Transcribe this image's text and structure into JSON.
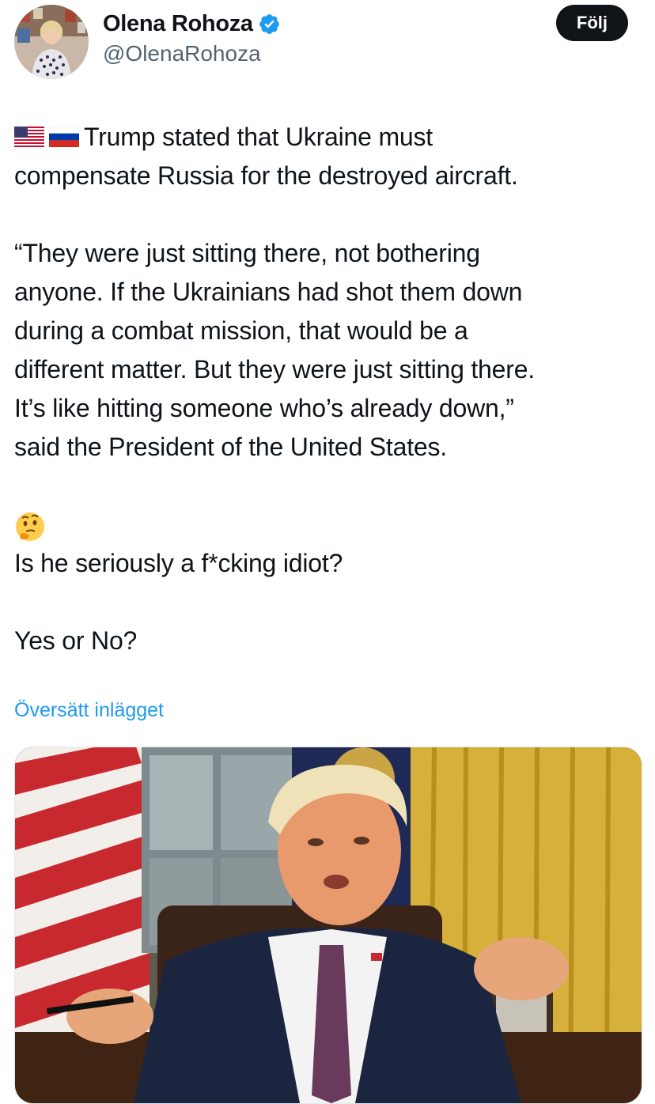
{
  "author": {
    "display_name": "Olena Rohoza",
    "handle": "@OlenaRohoza",
    "verified_icon": "verified-badge-icon",
    "verified_color": "#1d9bf0"
  },
  "follow_button": {
    "label": "Följ"
  },
  "tweet": {
    "flags": [
      "us-flag-icon",
      "russia-flag-icon"
    ],
    "line1": "Trump stated that Ukraine must",
    "line2": "compensate Russia for the destroyed aircraft.",
    "quote_lines": [
      "“They were just sitting there, not bothering",
      "anyone. If the Ukrainians had shot them down",
      "during a combat mission, that would be a",
      "different matter. But they were just sitting there.",
      "It’s like hitting someone who’s already down,”",
      "said the President of the United States."
    ],
    "emoji": "thinking-face-icon",
    "question": "Is he seriously a f*cking idiot?",
    "poll": "Yes or No?"
  },
  "translate_link": {
    "label": "Översätt inlägget",
    "color": "#1d9bf0"
  },
  "media": {
    "icon": "photo-of-man-in-office-icon"
  }
}
